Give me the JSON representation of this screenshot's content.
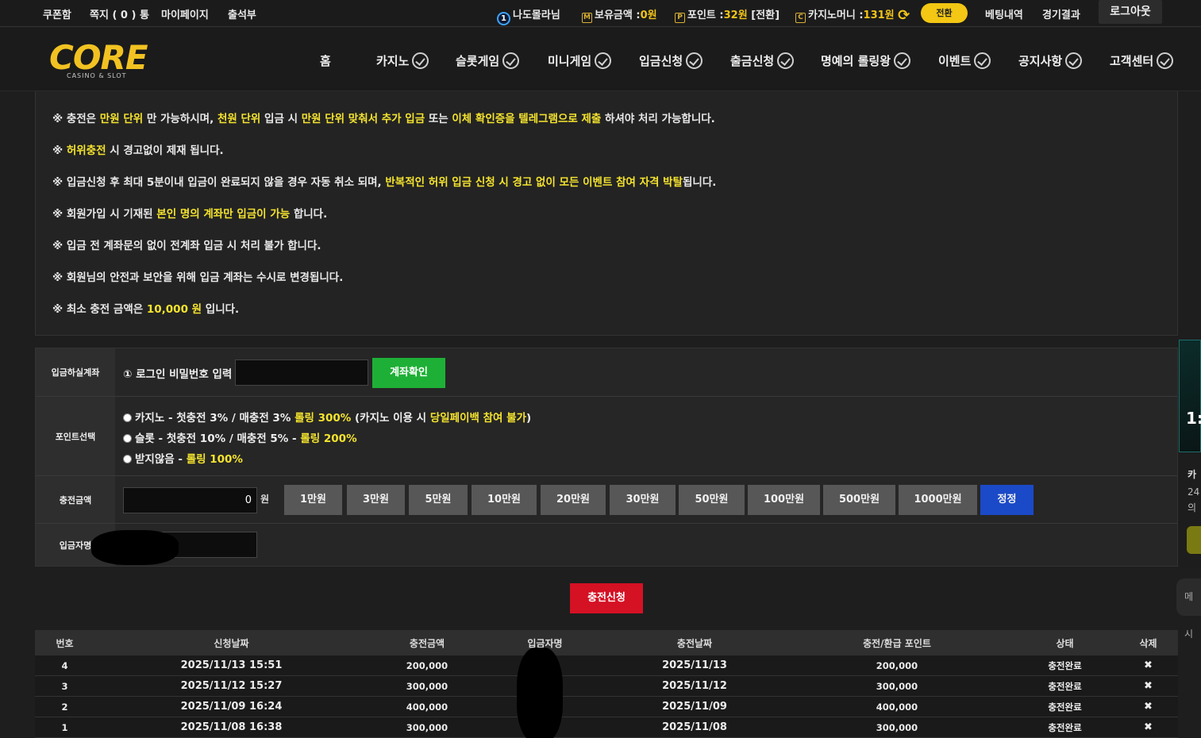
{
  "topbar": {
    "coupon": "쿠폰함",
    "message": "쪽지 ( 0 ) 통",
    "mypage": "마이페이지",
    "attendance": "출석부",
    "level": "1",
    "username": "나도몰라님",
    "balance_label": "보유금액 :",
    "balance_value": "0원",
    "point_label": "포인트 :",
    "point_value": "32원",
    "point_convert": "[전환]",
    "casino_label": "카지노머니 :",
    "casino_value": "131원",
    "convert": "전환",
    "betting_history": "베팅내역",
    "results": "경기결과",
    "logout": "로그아웃"
  },
  "logo": {
    "text": "CORE",
    "sub": "CASINO & SLOT"
  },
  "nav": [
    "홈",
    "카지노",
    "슬롯게임",
    "미니게임",
    "입금신청",
    "출금신청",
    "명예의 롤링왕",
    "이벤트",
    "공지사항",
    "고객센터"
  ],
  "notice": [
    [
      {
        "t": "※ 충전은 "
      },
      {
        "t": "만원 단위",
        "y": true
      },
      {
        "t": " 만 가능하시며, "
      },
      {
        "t": "천원 단위",
        "y": true
      },
      {
        "t": " 입금 시 "
      },
      {
        "t": "만원 단위 맞춰서 추가 입금",
        "y": true
      },
      {
        "t": " 또는 "
      },
      {
        "t": "이체 확인증을 텔레그램으로 제출",
        "y": true
      },
      {
        "t": " 하셔야 처리 가능합니다."
      }
    ],
    [
      {
        "t": "※ "
      },
      {
        "t": "허위충전",
        "y": true
      },
      {
        "t": " 시 경고없이 제재 됩니다."
      }
    ],
    [
      {
        "t": "※ 입금신청 후 최대 5분이내 입금이 완료되지 않을 경우 자동 취소 되며, "
      },
      {
        "t": "반복적인 허위 입금 신청 시 경고 없이 모든 이벤트 참여 자격 박탈",
        "y": true
      },
      {
        "t": "됩니다."
      }
    ],
    [
      {
        "t": "※ 회원가입 시 기재된 "
      },
      {
        "t": "본인 명의 계좌만 입금이 가능",
        "y": true
      },
      {
        "t": " 합니다."
      }
    ],
    [
      {
        "t": "※ 입금 전 계좌문의 없이 전계좌 입금 시 처리 불가 합니다."
      }
    ],
    [
      {
        "t": "※ 회원님의 안전과 보안을 위해 입금 계좌는 수시로 변경됩니다."
      }
    ],
    [
      {
        "t": "※ 최소 충전 금액은 "
      },
      {
        "t": "10,000 원",
        "y": true
      },
      {
        "t": " 입니다."
      }
    ]
  ],
  "form": {
    "account_label": "입금하실계좌",
    "password_prompt": "① 로그인 비밀번호 입력",
    "account_check": "계좌확인",
    "point_label": "포인트선택",
    "options": [
      [
        {
          "t": "카지노 - 첫충전 3% / 매충전 3% "
        },
        {
          "t": "롤링 300%",
          "y": true
        },
        {
          "t": " (카지노 이용 시 "
        },
        {
          "t": "당일페이백 참여 불가",
          "y": true
        },
        {
          "t": ")"
        }
      ],
      [
        {
          "t": "슬롯 - 첫충전 10% / 매충전 5% - "
        },
        {
          "t": "롤링 200%",
          "y": true
        }
      ],
      [
        {
          "t": "받지않음 - "
        },
        {
          "t": "롤링 100%",
          "y": true
        }
      ]
    ],
    "amount_label": "충전금액",
    "amount_value": "0",
    "amount_unit": "원",
    "amount_buttons": [
      "1만원",
      "3만원",
      "5만원",
      "10만원",
      "20만원",
      "30만원",
      "50만원",
      "100만원",
      "500만원",
      "1000만원"
    ],
    "reset": "정정",
    "depositor_label": "입금자명",
    "submit": "충전신청"
  },
  "table": {
    "headers": [
      "번호",
      "신청날짜",
      "충전금액",
      "입금자명",
      "충전날짜",
      "충전/환급 포인트",
      "상태",
      "삭제"
    ],
    "rows": [
      [
        "4",
        "2025/11/13 15:51",
        "200,000",
        "",
        "2025/11/13",
        "200,000",
        "충전완료",
        "✖"
      ],
      [
        "3",
        "2025/11/12 15:27",
        "300,000",
        "",
        "2025/11/12",
        "300,000",
        "충전완료",
        "✖"
      ],
      [
        "2",
        "2025/11/09 16:24",
        "400,000",
        "",
        "2025/11/09",
        "400,000",
        "충전완료",
        "✖"
      ],
      [
        "1",
        "2025/11/08 16:38",
        "300,000",
        "",
        "2025/11/08",
        "300,000",
        "충전완료",
        "✖"
      ]
    ]
  },
  "side": {
    "banner": "1:",
    "t1": "카",
    "t2": "24",
    "t3": "의",
    "msg": "메시"
  },
  "colors": {
    "accent_yellow": "#f4e32e",
    "gold": "#f0c419",
    "green": "#1eb036",
    "red": "#d51124",
    "blue": "#1b4ac8"
  }
}
